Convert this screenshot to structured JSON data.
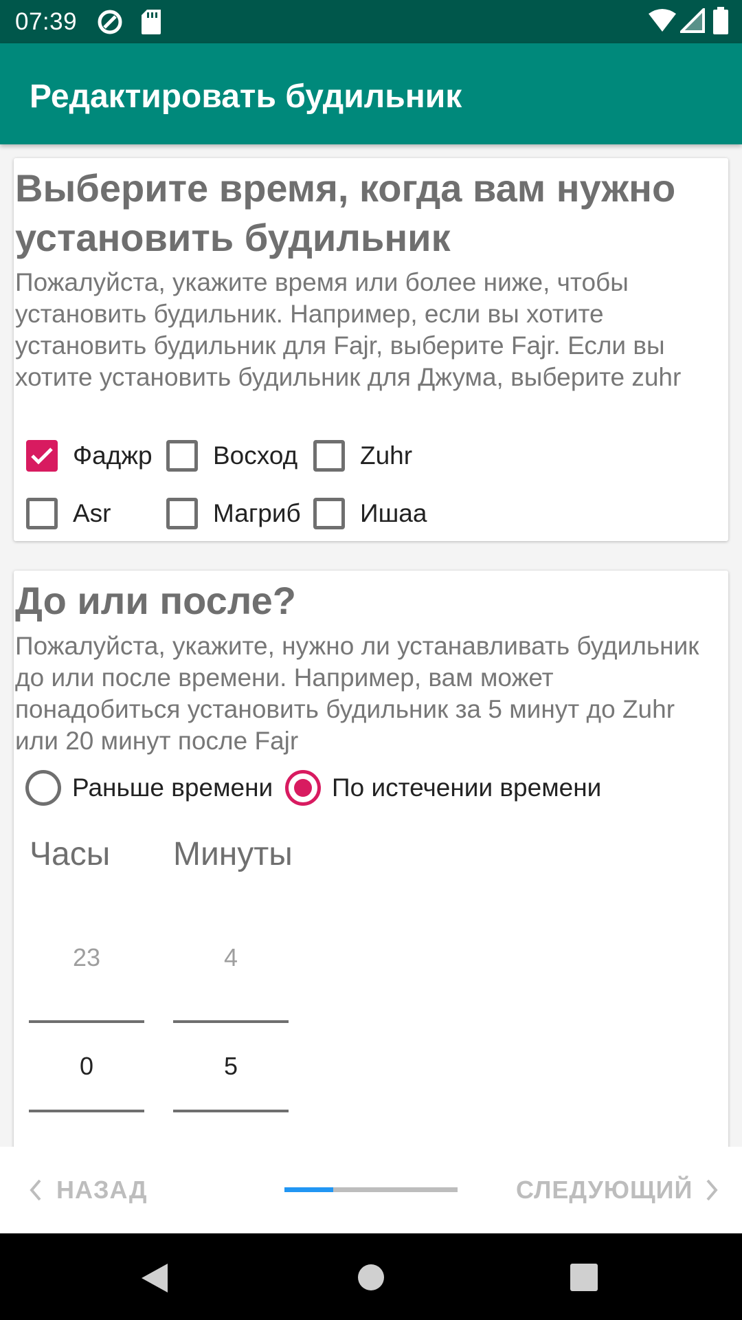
{
  "status_bar": {
    "time": "07:39"
  },
  "app_bar": {
    "title": "Редактировать будильник"
  },
  "prayer_card": {
    "title": "Выберите время, когда вам нужно установить будильник",
    "description": "Пожалуйста, укажите время или более ниже, чтобы установить будильник. Например, если вы хотите установить будильник для Fajr, выберите Fajr. Если вы хотите установить будильник для Джума, выберите zuhr",
    "options": [
      {
        "label": "Фаджр",
        "checked": true
      },
      {
        "label": "Восход",
        "checked": false
      },
      {
        "label": "Zuhr",
        "checked": false
      },
      {
        "label": "Asr",
        "checked": false
      },
      {
        "label": "Магриб",
        "checked": false
      },
      {
        "label": "Ишаа",
        "checked": false
      }
    ]
  },
  "timing_card": {
    "title": "До или после?",
    "description": "Пожалуйста, укажите, нужно ли устанавливать будильник до или после времени. Например, вам может понадобиться установить будильник за 5 минут до Zuhr или 20 минут после Fajr",
    "radios": [
      {
        "label": "Раньше времени",
        "checked": false
      },
      {
        "label": "По истечении времени",
        "checked": true
      }
    ],
    "hours": {
      "label": "Часы",
      "prev": "23",
      "value": "0"
    },
    "minutes": {
      "label": "Минуты",
      "prev": "4",
      "value": "5"
    }
  },
  "bottom_nav": {
    "back_label": "НАЗАД",
    "next_label": "СЛЕДУЮЩИЙ",
    "progress": 0.28,
    "accent": "#2196f3"
  },
  "colors": {
    "status_bar": "#00574b",
    "app_bar": "#00897b",
    "check_accent": "#d81b60"
  }
}
